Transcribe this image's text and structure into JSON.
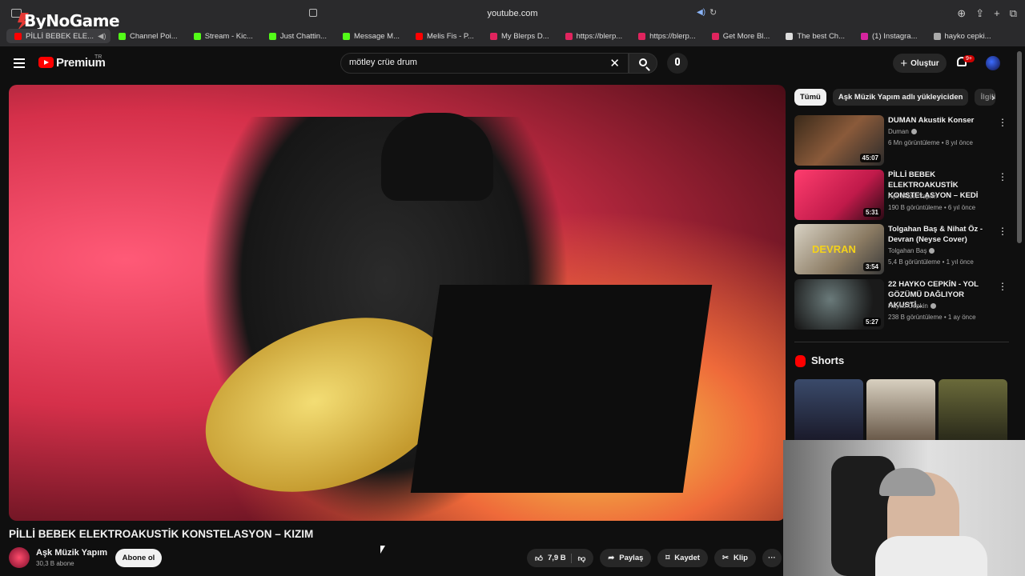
{
  "browser": {
    "url": "youtube.com",
    "overlay_logo": "ByNoGame",
    "tabs": [
      {
        "label": "PİLLİ BEBEK ELE...",
        "color": "#ff0000"
      },
      {
        "label": "Channel Poi...",
        "color": "#53fc18"
      },
      {
        "label": "Stream - Kic...",
        "color": "#53fc18"
      },
      {
        "label": "Just Chattin...",
        "color": "#53fc18"
      },
      {
        "label": "Message M...",
        "color": "#53fc18"
      },
      {
        "label": "Melis Fis - P...",
        "color": "#ff0000"
      },
      {
        "label": "My Blerps D...",
        "color": "#e0245e"
      },
      {
        "label": "https://blerp...",
        "color": "#e0245e"
      },
      {
        "label": "https://blerp...",
        "color": "#e0245e"
      },
      {
        "label": "Get More Bl...",
        "color": "#e0245e"
      },
      {
        "label": "The best Ch...",
        "color": "#dddddd"
      },
      {
        "label": "(1) Instagra...",
        "color": "#d6249f"
      },
      {
        "label": "hayko cepki...",
        "color": "#aaaaaa"
      }
    ]
  },
  "header": {
    "brand": "Premium",
    "region": "TR",
    "search_query": "mötley crüe drum",
    "create_label": "Oluştur",
    "notif_count": "9+"
  },
  "video": {
    "title": "PİLLİ BEBEK ELEKTROAKUSTİK KONSTELASYON – KIZIM",
    "channel": "Aşk Müzik Yapım",
    "subscribers": "30,3 B abone",
    "subscribe_label": "Abone ol",
    "likes": "7,9 B",
    "share_label": "Paylaş",
    "save_label": "Kaydet",
    "clip_label": "Klip"
  },
  "chips": [
    "Tümü",
    "Aşk Müzik Yapım adlı yükleyiciden",
    "İlgili"
  ],
  "recommendations": [
    {
      "title": "DUMAN Akustik Konser",
      "channel": "Duman",
      "meta": "6 Mn görüntüleme • 8 yıl önce",
      "duration": "45:07",
      "verified": true
    },
    {
      "title": "PİLLİ BEBEK ELEKTROAKUSTİK KONSTELASYON – KEDİ",
      "channel": "Aşk Müzik Yapım",
      "meta": "190 B görüntüleme • 6 yıl önce",
      "duration": "5:31",
      "verified": false
    },
    {
      "title": "Tolgahan Baş & Nihat Öz - Devran (Neyse Cover)",
      "channel": "Tolgahan Baş",
      "meta": "5,4 B görüntüleme • 1 yıl önce",
      "duration": "3:54",
      "verified": true
    },
    {
      "title": "22 HAYKO CEPKİN - YOL GÖZÜMÜ DAĞLIYOR AKUSTİ...",
      "channel": "Hayko Cepkin",
      "meta": "238 B görüntüleme • 1 ay önce",
      "duration": "5:27",
      "verified": true
    }
  ],
  "shorts": {
    "heading": "Shorts"
  }
}
